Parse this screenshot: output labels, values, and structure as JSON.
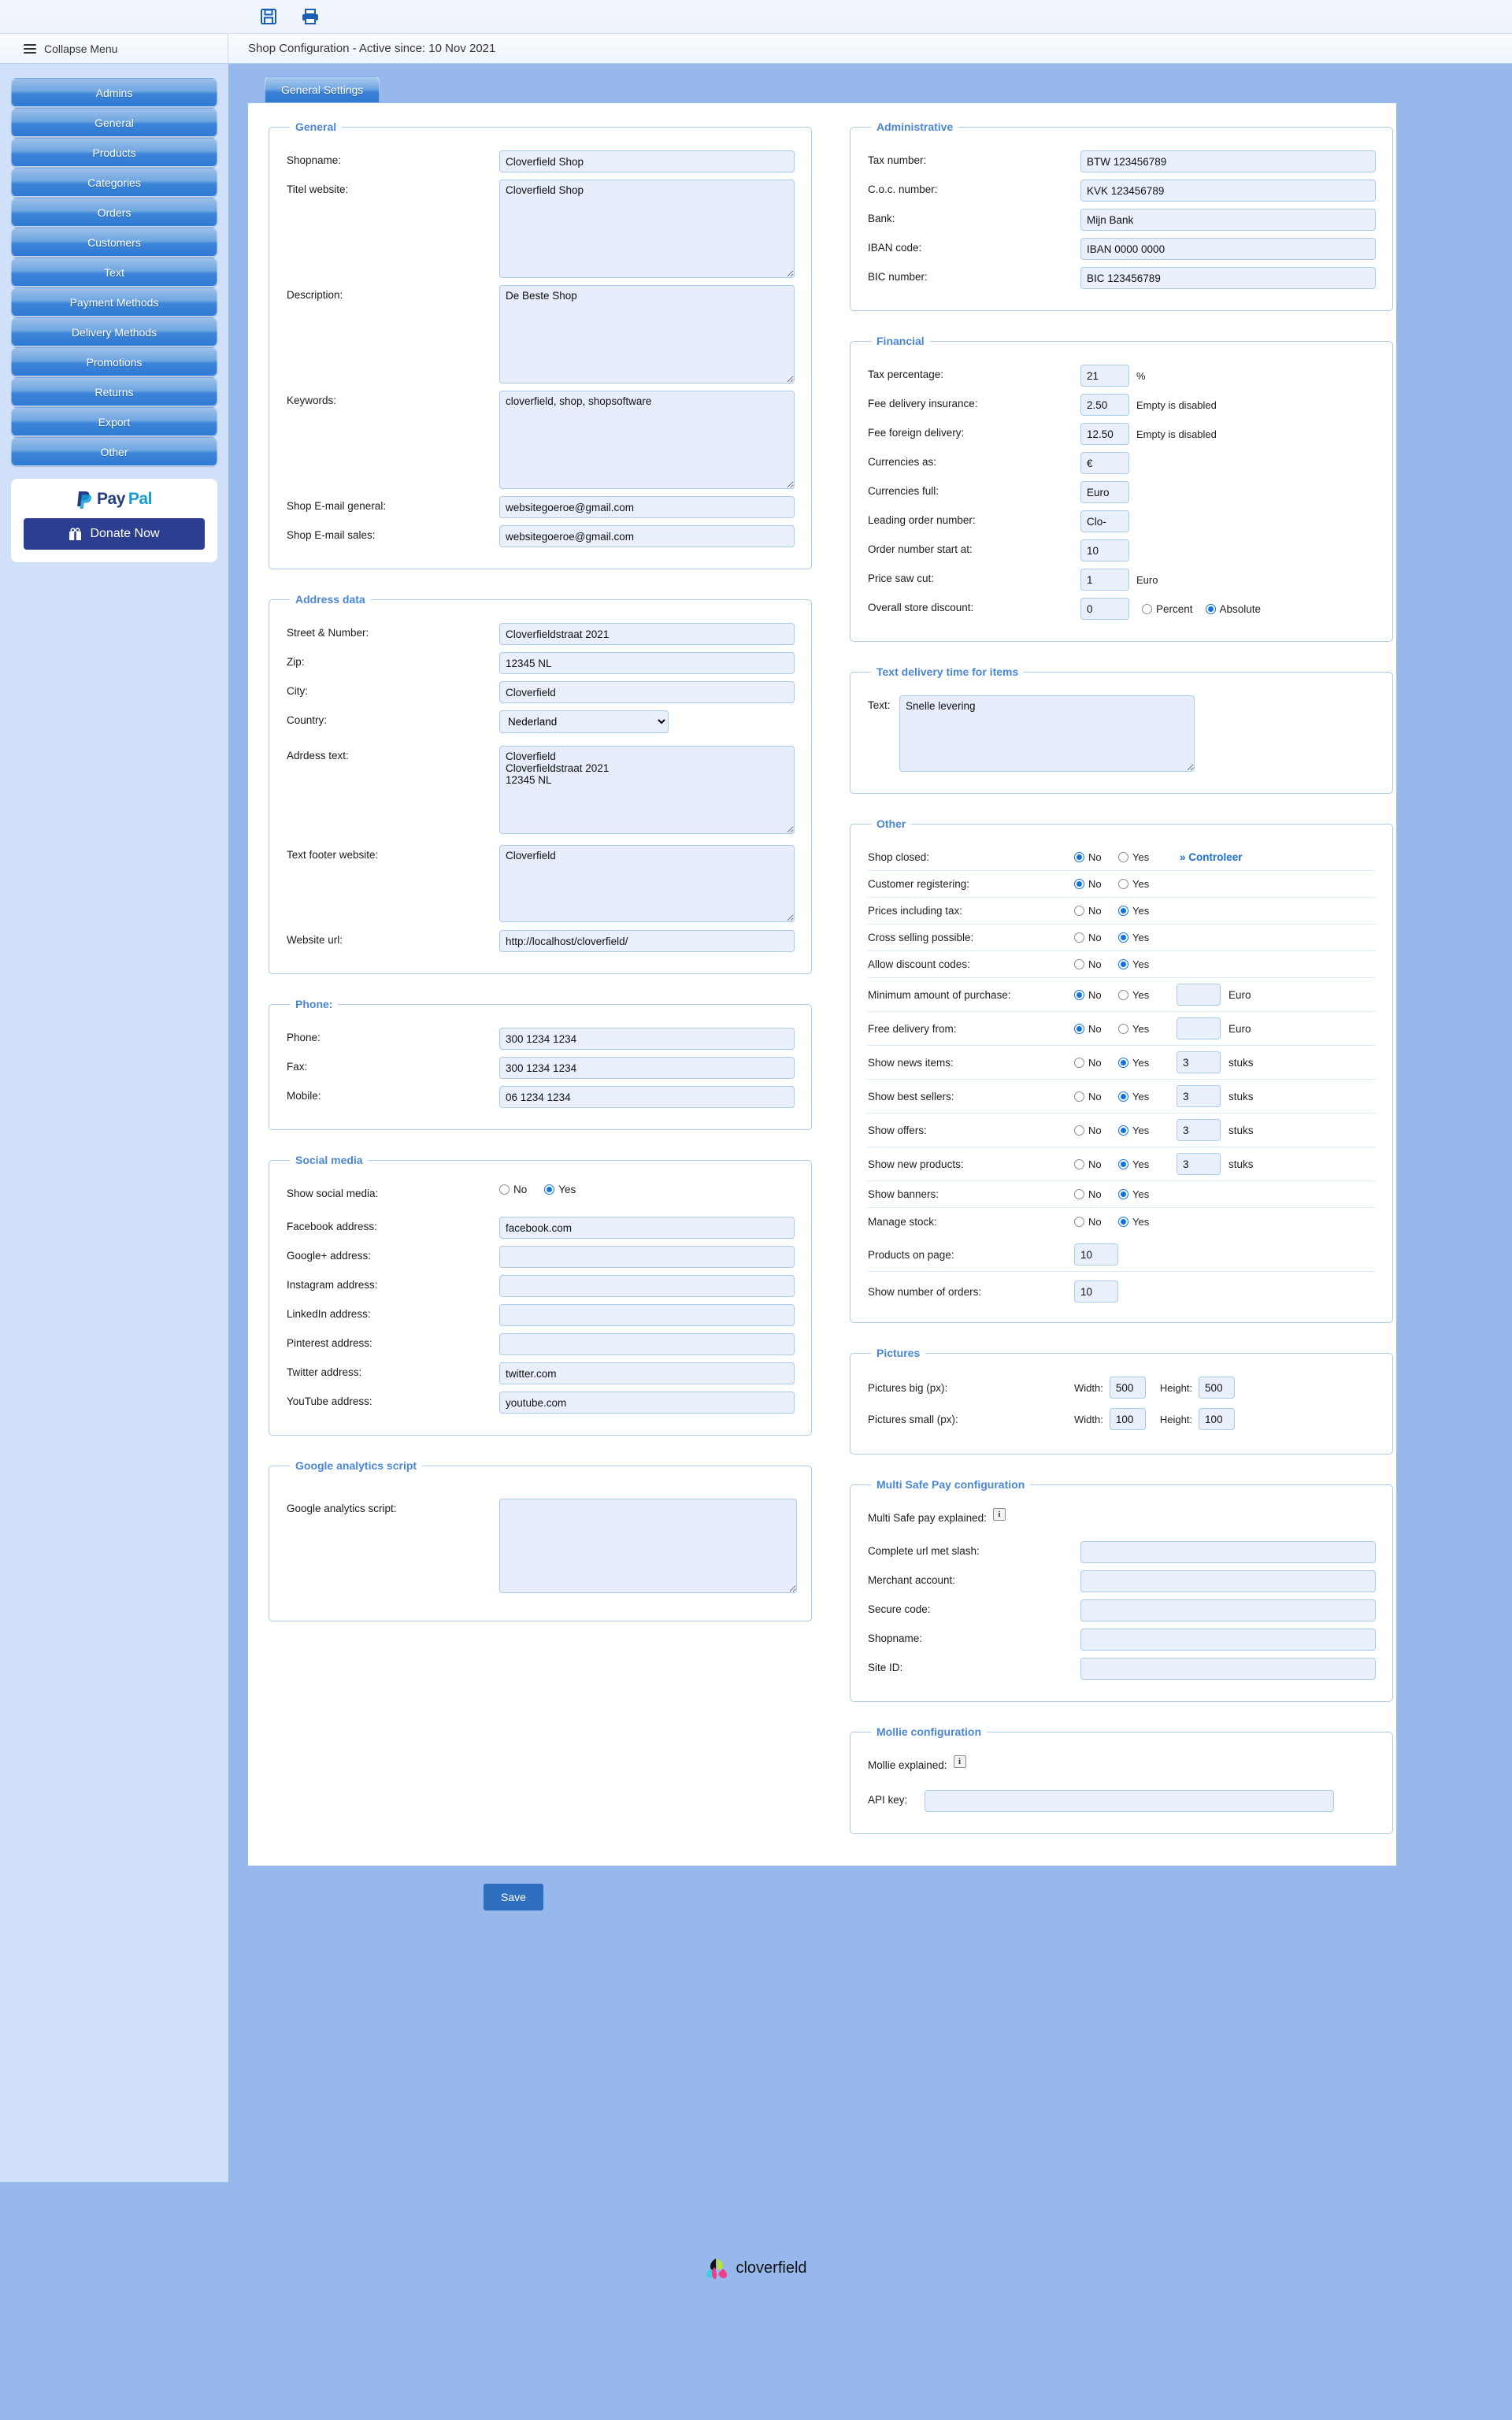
{
  "header": {
    "save_icon": "floppy-disk-icon",
    "print_icon": "printer-icon",
    "collapse_label": "Collapse Menu",
    "page_title": "Shop Configuration - Active since: 10 Nov 2021"
  },
  "sidebar": {
    "items": [
      {
        "label": "Admins"
      },
      {
        "label": "General"
      },
      {
        "label": "Products"
      },
      {
        "label": "Categories"
      },
      {
        "label": "Orders"
      },
      {
        "label": "Customers"
      },
      {
        "label": "Text"
      },
      {
        "label": "Payment Methods"
      },
      {
        "label": "Delivery Methods"
      },
      {
        "label": "Promotions"
      },
      {
        "label": "Returns"
      },
      {
        "label": "Export"
      },
      {
        "label": "Other"
      }
    ],
    "paypal": {
      "logo_pay": "Pay",
      "logo_pal": "Pal",
      "donate_label": "Donate Now"
    }
  },
  "tabs": [
    {
      "label": "General Settings",
      "active": true
    }
  ],
  "general": {
    "legend": "General",
    "shopname_label": "Shopname:",
    "shopname_value": "Cloverfield Shop",
    "title_label": "Titel website:",
    "title_value": "Cloverfield Shop",
    "description_label": "Description:",
    "description_value": "De Beste Shop",
    "keywords_label": "Keywords:",
    "keywords_value": "cloverfield, shop, shopsoftware",
    "email_general_label": "Shop E-mail general:",
    "email_general_value": "websitegoeroe@gmail.com",
    "email_sales_label": "Shop E-mail sales:",
    "email_sales_value": "websitegoeroe@gmail.com"
  },
  "address": {
    "legend": "Address data",
    "street_label": "Street & Number:",
    "street_value": "Cloverfieldstraat 2021",
    "zip_label": "Zip:",
    "zip_value": "12345 NL",
    "city_label": "City:",
    "city_value": "Cloverfield",
    "country_label": "Country:",
    "country_value": "Nederland",
    "address_text_label": "Adrdess text:",
    "address_text_value": "Cloverfield\nCloverfieldstraat 2021\n12345 NL",
    "footer_text_label": "Text footer website:",
    "footer_text_value": "Cloverfield",
    "url_label": "Website url:",
    "url_value": "http://localhost/cloverfield/"
  },
  "phone": {
    "legend": "Phone:",
    "phone_label": "Phone:",
    "phone_value": "300 1234 1234",
    "fax_label": "Fax:",
    "fax_value": "300 1234 1234",
    "mobile_label": "Mobile:",
    "mobile_value": "06 1234 1234"
  },
  "social": {
    "legend": "Social media",
    "show_label": "Show social media:",
    "show_no": "No",
    "show_yes": "Yes",
    "show_selected": "Yes",
    "facebook_label": "Facebook address:",
    "facebook_value": "facebook.com",
    "google_label": "Google+ address:",
    "google_value": "",
    "instagram_label": "Instagram address:",
    "instagram_value": "",
    "linkedin_label": "LinkedIn address:",
    "linkedin_value": "",
    "pinterest_label": "Pinterest address:",
    "pinterest_value": "",
    "twitter_label": "Twitter address:",
    "twitter_value": "twitter.com",
    "youtube_label": "YouTube address:",
    "youtube_value": "youtube.com"
  },
  "analytics": {
    "legend": "Google analytics script",
    "label": "Google analytics script:",
    "value": ""
  },
  "administrative": {
    "legend": "Administrative",
    "tax_label": "Tax number:",
    "tax_value": "BTW 123456789",
    "coc_label": "C.o.c. number:",
    "coc_value": "KVK 123456789",
    "bank_label": "Bank:",
    "bank_value": "Mijn Bank",
    "iban_label": "IBAN code:",
    "iban_value": "IBAN 0000 0000",
    "bic_label": "BIC number:",
    "bic_value": "BIC 123456789"
  },
  "financial": {
    "legend": "Financial",
    "tax_pct_label": "Tax percentage:",
    "tax_pct_value": "21",
    "tax_pct_unit": "%",
    "fee_ins_label": "Fee delivery insurance:",
    "fee_ins_value": "2.50",
    "fee_ins_hint": "Empty is disabled",
    "fee_for_label": "Fee foreign delivery:",
    "fee_for_value": "12.50",
    "fee_for_hint": "Empty is disabled",
    "cur_as_label": "Currencies as:",
    "cur_as_value": "€",
    "cur_full_label": "Currencies full:",
    "cur_full_value": "Euro",
    "lead_label": "Leading order number:",
    "lead_value": "Clo-",
    "order_start_label": "Order number start at:",
    "order_start_value": "10",
    "saw_label": "Price saw cut:",
    "saw_value": "1",
    "saw_unit": "Euro",
    "discount_label": "Overall store discount:",
    "discount_value": "0",
    "discount_percent": "Percent",
    "discount_absolute": "Absolute",
    "discount_selected": "Absolute"
  },
  "delivery_text": {
    "legend": "Text delivery time for items",
    "label": "Text:",
    "value": "Snelle levering"
  },
  "other": {
    "legend": "Other",
    "no_label": "No",
    "yes_label": "Yes",
    "controleer_label": "» Controleer",
    "rows": [
      {
        "label": "Shop closed:",
        "selected": "No",
        "link": "» Controleer"
      },
      {
        "label": "Customer registering:",
        "selected": "No"
      },
      {
        "label": "Prices including tax:",
        "selected": "Yes"
      },
      {
        "label": "Cross selling possible:",
        "selected": "Yes"
      },
      {
        "label": "Allow discount codes:",
        "selected": "Yes"
      },
      {
        "label": "Minimum amount of purchase:",
        "selected": "No",
        "input": "",
        "unit": "Euro"
      },
      {
        "label": "Free delivery from:",
        "selected": "No",
        "input": "",
        "unit": "Euro"
      },
      {
        "label": "Show news items:",
        "selected": "Yes",
        "input": "3",
        "unit": "stuks"
      },
      {
        "label": "Show best sellers:",
        "selected": "Yes",
        "input": "3",
        "unit": "stuks"
      },
      {
        "label": "Show offers:",
        "selected": "Yes",
        "input": "3",
        "unit": "stuks"
      },
      {
        "label": "Show new products:",
        "selected": "Yes",
        "input": "3",
        "unit": "stuks"
      },
      {
        "label": "Show banners:",
        "selected": "Yes"
      },
      {
        "label": "Manage stock:",
        "selected": "Yes"
      }
    ],
    "products_on_page_label": "Products on page:",
    "products_on_page_value": "10",
    "orders_shown_label": "Show number of orders:",
    "orders_shown_value": "10"
  },
  "pictures": {
    "legend": "Pictures",
    "big_label": "Pictures big (px):",
    "small_label": "Pictures small (px):",
    "width_label": "Width:",
    "height_label": "Height:",
    "big_width": "500",
    "big_height": "500",
    "small_width": "100",
    "small_height": "100"
  },
  "msp": {
    "legend": "Multi Safe Pay configuration",
    "explained_label": "Multi Safe pay explained:",
    "url_label": "Complete url met slash:",
    "url_value": "",
    "merchant_label": "Merchant account:",
    "merchant_value": "",
    "secure_label": "Secure code:",
    "secure_value": "",
    "shopname_label": "Shopname:",
    "shopname_value": "",
    "siteid_label": "Site ID:",
    "siteid_value": ""
  },
  "mollie": {
    "legend": "Mollie configuration",
    "explained_label": "Mollie explained:",
    "api_label": "API key:",
    "api_value": ""
  },
  "actions": {
    "save_label": "Save"
  },
  "footer": {
    "brand": "cloverfield"
  }
}
